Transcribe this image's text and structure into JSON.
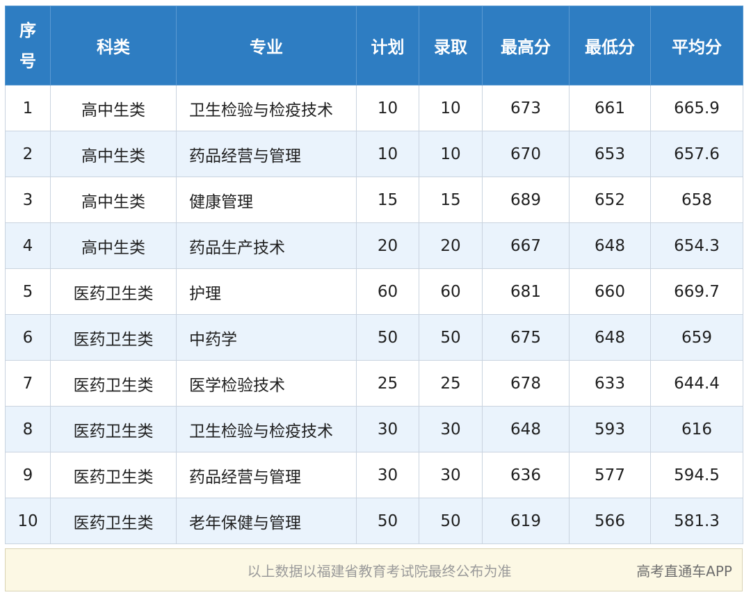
{
  "table": {
    "headers": {
      "seq_line1": "序",
      "seq_line2": "号",
      "category": "科类",
      "major": "专业",
      "plan": "计划",
      "admitted": "录取",
      "max": "最高分",
      "min": "最低分",
      "avg": "平均分"
    },
    "rows": [
      {
        "seq": "1",
        "category": "高中生类",
        "major": "卫生检验与检疫技术",
        "plan": "10",
        "admitted": "10",
        "max": "673",
        "min": "661",
        "avg": "665.9"
      },
      {
        "seq": "2",
        "category": "高中生类",
        "major": "药品经营与管理",
        "plan": "10",
        "admitted": "10",
        "max": "670",
        "min": "653",
        "avg": "657.6"
      },
      {
        "seq": "3",
        "category": "高中生类",
        "major": "健康管理",
        "plan": "15",
        "admitted": "15",
        "max": "689",
        "min": "652",
        "avg": "658"
      },
      {
        "seq": "4",
        "category": "高中生类",
        "major": "药品生产技术",
        "plan": "20",
        "admitted": "20",
        "max": "667",
        "min": "648",
        "avg": "654.3"
      },
      {
        "seq": "5",
        "category": "医药卫生类",
        "major": "护理",
        "plan": "60",
        "admitted": "60",
        "max": "681",
        "min": "660",
        "avg": "669.7"
      },
      {
        "seq": "6",
        "category": "医药卫生类",
        "major": "中药学",
        "plan": "50",
        "admitted": "50",
        "max": "675",
        "min": "648",
        "avg": "659"
      },
      {
        "seq": "7",
        "category": "医药卫生类",
        "major": "医学检验技术",
        "plan": "25",
        "admitted": "25",
        "max": "678",
        "min": "633",
        "avg": "644.4"
      },
      {
        "seq": "8",
        "category": "医药卫生类",
        "major": "卫生检验与检疫技术",
        "plan": "30",
        "admitted": "30",
        "max": "648",
        "min": "593",
        "avg": "616"
      },
      {
        "seq": "9",
        "category": "医药卫生类",
        "major": "药品经营与管理",
        "plan": "30",
        "admitted": "30",
        "max": "636",
        "min": "577",
        "avg": "594.5"
      },
      {
        "seq": "10",
        "category": "医药卫生类",
        "major": "老年保健与管理",
        "plan": "50",
        "admitted": "50",
        "max": "619",
        "min": "566",
        "avg": "581.3"
      }
    ]
  },
  "footer": {
    "note": "以上数据以福建省教育考试院最终公布为准",
    "brand": "高考直通车APP"
  },
  "colors": {
    "header_bg": "#2e7dc2",
    "header_text": "#ffffff",
    "alt_row_bg": "#eaf3fc",
    "footer_bg": "#fcf8e4"
  }
}
